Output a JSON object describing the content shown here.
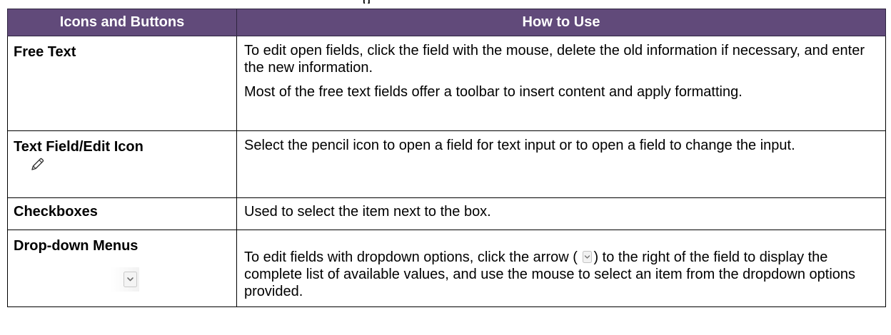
{
  "page_fragment": "g",
  "table": {
    "headers": [
      "Icons and Buttons",
      "How to Use"
    ],
    "rows": [
      {
        "name": "Free Text",
        "paragraphs": [
          "To edit open fields, click the field with the mouse, delete the old information if necessary, and enter the new information.",
          "Most of the free text fields offer a toolbar to insert content and apply formatting."
        ]
      },
      {
        "name": "Text Field/Edit Icon",
        "icon": "pencil-icon",
        "paragraphs": [
          "Select the pencil icon to open a field for text input or to open a field to change the input."
        ]
      },
      {
        "name": "Checkboxes",
        "paragraphs": [
          "Used to select the item next to the box."
        ]
      },
      {
        "name": "Drop-down Menus",
        "icon": "dropdown-arrow-icon",
        "text_before_icon": "To edit fields with dropdown options, click the arrow (",
        "text_after_icon": ") to the right of the field to display the complete list of available values, and use the mouse to select an item from the dropdown options provided."
      }
    ]
  },
  "colors": {
    "header_bg": "#614a7a",
    "header_text": "#ffffff",
    "border": "#000000"
  }
}
